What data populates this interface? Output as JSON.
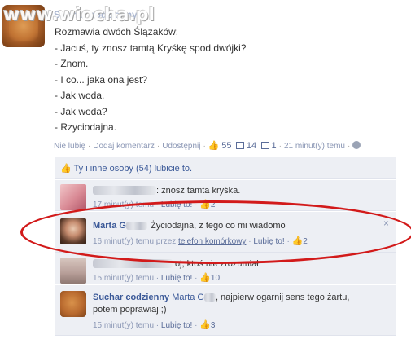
{
  "watermark": "www.wiocha.pl",
  "post": {
    "author": "Suchar codzienny",
    "lines": [
      "Rozmawia dwóch Ślązaków:",
      "- Jacuś, ty znosz tamtą Kryśkę spod dwójki?",
      "- Znom.",
      "- I co... jaka ona jest?",
      "- Jak woda.",
      "- Jak woda?",
      "- Rzyciodajna."
    ],
    "actions": {
      "unlike": "Nie lubię",
      "comment": "Dodaj komentarz",
      "share": "Udostępnij",
      "likes": "55",
      "comments": "14",
      "shares": "1",
      "time": "21 minut(y) temu"
    },
    "likes_bar": "Ty i inne osoby (54) lubicie to."
  },
  "comments": [
    {
      "name": "",
      "text": ": znosz tamta kryśka.",
      "time": "17 minut(y) temu",
      "like": "Lubię to!",
      "likes": "2"
    },
    {
      "name": "Marta G",
      "text": "Życiodajna, z tego co mi wiadomo",
      "time": "16 minut(y) temu przez",
      "via": "telefon komórkowy",
      "like": "Lubię to!",
      "likes": "2",
      "close": "×"
    },
    {
      "name": "",
      "text": "oj, ktoś nie zrozumiał",
      "time": "15 minut(y) temu",
      "like": "Lubię to!",
      "likes": "10"
    },
    {
      "name": "Suchar codzienny",
      "mention": "Marta G",
      "text": ", najpierw ogarnij sens tego żartu, potem poprawiaj ;)",
      "time": "15 minut(y) temu",
      "like": "Lubię to!",
      "likes": "3"
    }
  ],
  "colors": {
    "link": "#3b5998",
    "highlight": "#d21a1a",
    "panel": "#edeff4"
  }
}
